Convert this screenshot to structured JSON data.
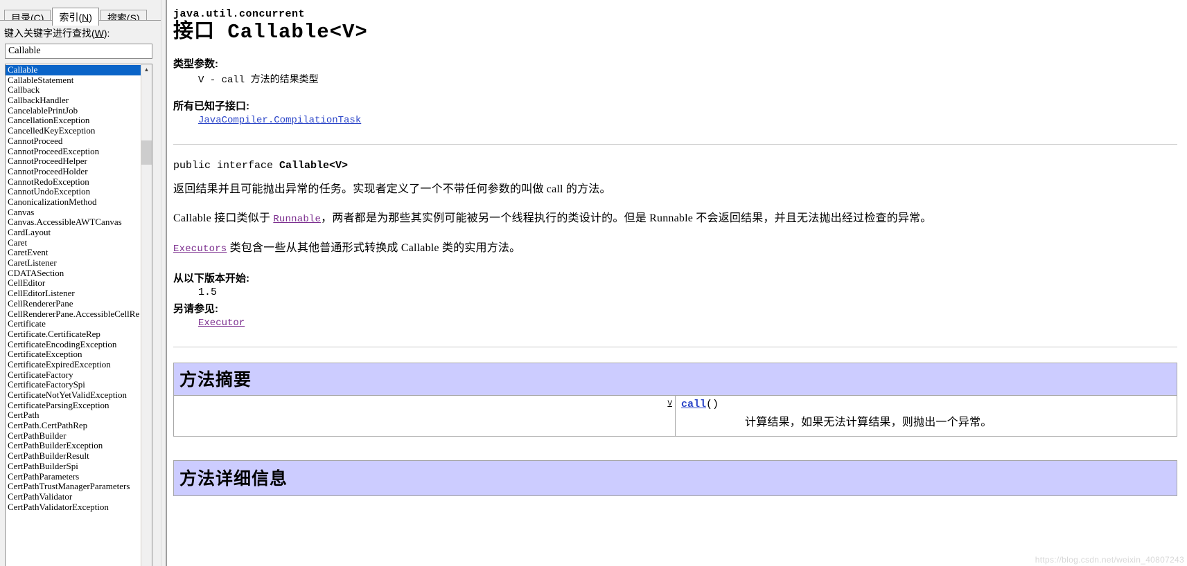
{
  "help_window": {
    "tabs": [
      {
        "label_pre": "目录(",
        "accel": "C",
        "label_post": ")",
        "active": false,
        "name": "contents"
      },
      {
        "label_pre": "索引(",
        "accel": "N",
        "label_post": ")",
        "active": true,
        "name": "index"
      },
      {
        "label_pre": "搜索(",
        "accel": "S",
        "label_post": ")",
        "active": false,
        "name": "search"
      }
    ],
    "keyword_label_pre": "键入关键字进行查找(",
    "keyword_label_accel": "W",
    "keyword_label_post": "):",
    "keyword_value": "Callable",
    "index_items": [
      "Callable",
      "CallableStatement",
      "Callback",
      "CallbackHandler",
      "CancelablePrintJob",
      "CancellationException",
      "CancelledKeyException",
      "CannotProceed",
      "CannotProceedException",
      "CannotProceedHelper",
      "CannotProceedHolder",
      "CannotRedoException",
      "CannotUndoException",
      "CanonicalizationMethod",
      "Canvas",
      "Canvas.AccessibleAWTCanvas",
      "CardLayout",
      "Caret",
      "CaretEvent",
      "CaretListener",
      "CDATASection",
      "CellEditor",
      "CellEditorListener",
      "CellRendererPane",
      "CellRendererPane.AccessibleCellRe",
      "Certificate",
      "Certificate.CertificateRep",
      "CertificateEncodingException",
      "CertificateException",
      "CertificateExpiredException",
      "CertificateFactory",
      "CertificateFactorySpi",
      "CertificateNotYetValidException",
      "CertificateParsingException",
      "CertPath",
      "CertPath.CertPathRep",
      "CertPathBuilder",
      "CertPathBuilderException",
      "CertPathBuilderResult",
      "CertPathBuilderSpi",
      "CertPathParameters",
      "CertPathTrustManagerParameters",
      "CertPathValidator",
      "CertPathValidatorException"
    ],
    "selected_index": 0,
    "scroll_up_glyph": "▲",
    "scroll_down_glyph": "▼"
  },
  "doc": {
    "package": "java.util.concurrent",
    "title": "接口 Callable<V>",
    "type_params_heading": "类型参数:",
    "type_param_text": "V - call 方法的结果类型",
    "subinterfaces_heading": "所有已知子接口:",
    "subinterface_link": "JavaCompiler.CompilationTask",
    "declaration_modifier": "public interface ",
    "declaration_name": "Callable<V>",
    "para1": "返回结果并且可能抛出异常的任务。实现者定义了一个不带任何参数的叫做 call 的方法。",
    "para2_a": "Callable 接口类似于 ",
    "para2_link": "Runnable",
    "para2_b": "，两者都是为那些其实例可能被另一个线程执行的类设计的。但是 Runnable 不会返回结果，并且无法抛出经过检查的异常。",
    "para3_link": "Executors",
    "para3_text": " 类包含一些从其他普通形式转换成 Callable 类的实用方法。",
    "since_heading": "从以下版本开始:",
    "since_value": "1.5",
    "seealso_heading": "另请参见:",
    "seealso_link": "Executor",
    "method_summary_heading": "方法摘要",
    "method_return_type": "V",
    "method_name": "call",
    "method_parens": "()",
    "method_desc": "计算结果，如果无法计算结果，则抛出一个异常。",
    "method_detail_heading": "方法详细信息"
  },
  "watermark": "https://blog.csdn.net/weixin_40807243"
}
